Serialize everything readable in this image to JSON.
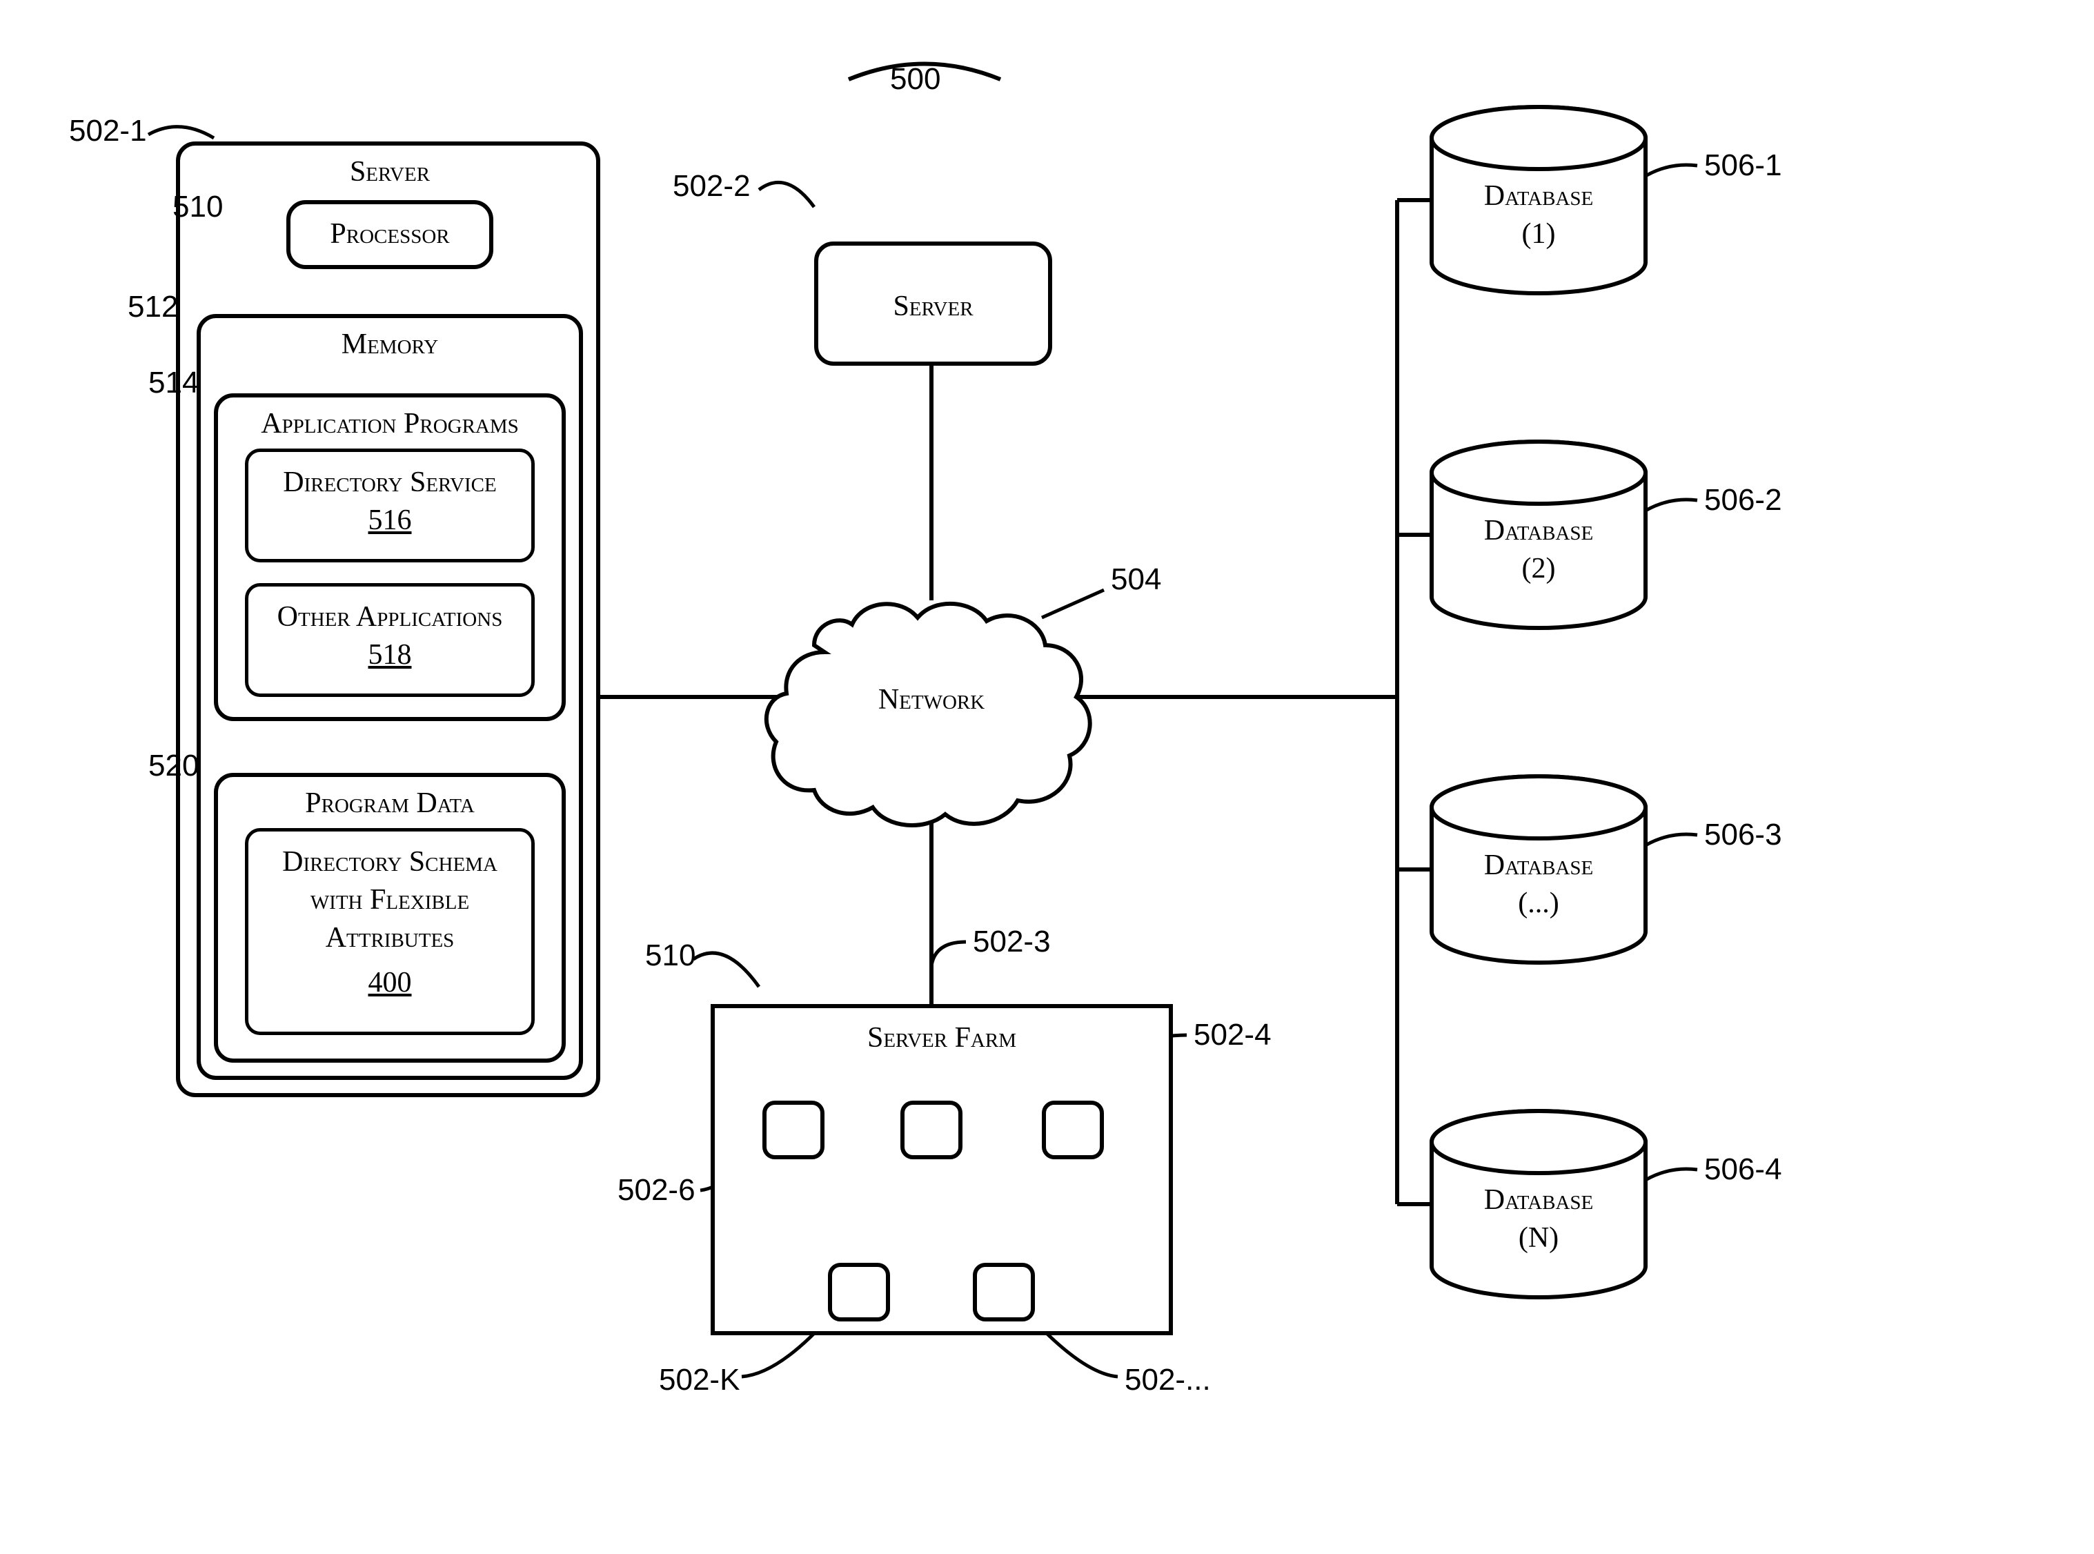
{
  "figure": {
    "top_ref": "500"
  },
  "server_main": {
    "ref": "502-1",
    "title": "Server",
    "processor": {
      "ref": "510",
      "label": "Processor"
    },
    "memory": {
      "ref": "512",
      "title": "Memory",
      "app_programs": {
        "ref": "514",
        "title": "Application Programs",
        "directory_service": {
          "label": "Directory Service",
          "num": "516"
        },
        "other_apps": {
          "label": "Other Applications",
          "num": "518"
        }
      },
      "program_data": {
        "ref": "520",
        "title": "Program Data",
        "schema": {
          "label_l1": "Directory Schema",
          "label_l2": "with Flexible",
          "label_l3": "Attributes",
          "num": "400"
        }
      }
    }
  },
  "server_2": {
    "ref": "502-2",
    "label": "Server"
  },
  "network": {
    "ref": "504",
    "label": "Network"
  },
  "server_farm": {
    "ref": "510",
    "title": "Server Farm",
    "nodes": {
      "n1": "502-3",
      "n2": "502-4",
      "n3": "502-6",
      "n4": "502-K",
      "n5": "502-..."
    }
  },
  "databases": {
    "d1": {
      "label_l1": "Database",
      "label_l2": "(1)",
      "ref": "506-1"
    },
    "d2": {
      "label_l1": "Database",
      "label_l2": "(2)",
      "ref": "506-2"
    },
    "d3": {
      "label_l1": "Database",
      "label_l2": "(...)",
      "ref": "506-3"
    },
    "d4": {
      "label_l1": "Database",
      "label_l2": "(N)",
      "ref": "506-4"
    }
  }
}
